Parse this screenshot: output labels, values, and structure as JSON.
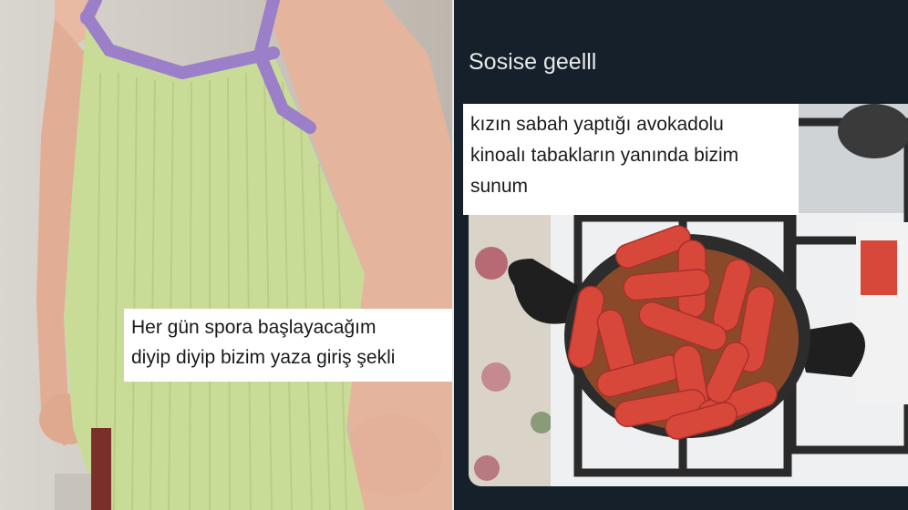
{
  "left_panel": {
    "caption": "Her gün spora başlayacağım\ndiyip diyip bizim yaza giriş şekli"
  },
  "right_panel": {
    "tweet_text": "Sosise geelll",
    "image_caption": "kızın sabah yaptığı avokadolu\nkinoalı tabakların yanında bizim\nsunum"
  },
  "colors": {
    "tweet_background": "#15202b",
    "tweet_text": "#e7e9ea",
    "caption_background": "#ffffff",
    "tank_top": "#c8dc98",
    "tank_trim": "#9b7fc8",
    "sausage": "#d8483a"
  }
}
